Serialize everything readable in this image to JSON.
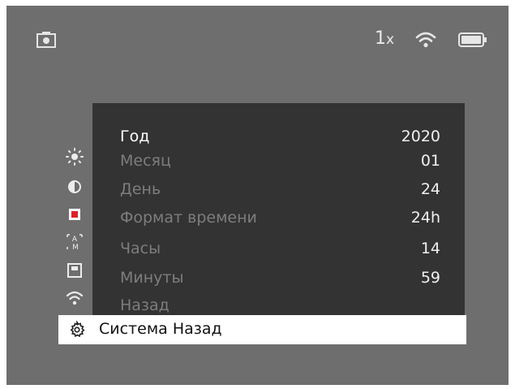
{
  "status_bar": {
    "zoom_value": "1",
    "zoom_unit": "x",
    "icons": [
      "camera-icon",
      "wifi-icon",
      "battery-icon"
    ]
  },
  "side_menu": {
    "icons": [
      "brightness-icon",
      "contrast-icon",
      "record-icon",
      "auto-mode-icon",
      "save-icon",
      "wifi-icon"
    ]
  },
  "submenu": {
    "rows": [
      {
        "label": "Год",
        "value": "2020",
        "active": true
      },
      {
        "label": "Месяц",
        "value": "01"
      },
      {
        "label": "День",
        "value": "24"
      },
      {
        "label": "Формат времени",
        "value": "24h"
      },
      {
        "label": "Часы",
        "value": "14"
      },
      {
        "label": "Минуты",
        "value": "59"
      },
      {
        "label": "Назад",
        "value": ""
      }
    ]
  },
  "system_bar": {
    "label": "Система Назад",
    "icon": "gear-icon"
  },
  "colors": {
    "screen_bg": "#6e6e6e",
    "submenu_bg": "#333333",
    "highlight_bg": "#ffffff",
    "record_red": "#e0202a"
  }
}
